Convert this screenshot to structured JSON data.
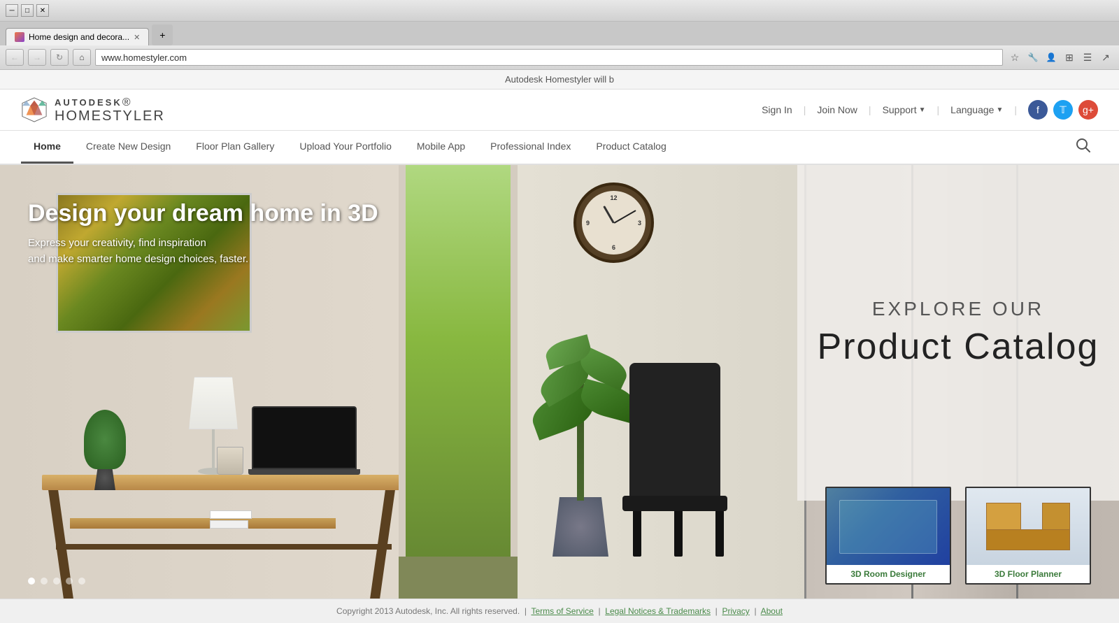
{
  "browser": {
    "tab_title": "Home design and decora...",
    "url": "www.homestyler.com",
    "loading": false
  },
  "notification": {
    "text": "Autodesk Homestyler will b"
  },
  "header": {
    "logo_brand": "AUTODESK",
    "logo_product": "HOMESTYLER",
    "sign_in": "Sign In",
    "join_now": "Join Now",
    "support": "Support",
    "language": "Language"
  },
  "nav": {
    "items": [
      {
        "label": "Home",
        "active": true
      },
      {
        "label": "Create New Design",
        "active": false
      },
      {
        "label": "Floor Plan Gallery",
        "active": false
      },
      {
        "label": "Upload Your Portfolio",
        "active": false
      },
      {
        "label": "Mobile App",
        "active": false
      },
      {
        "label": "Professional Index",
        "active": false
      },
      {
        "label": "Product Catalog",
        "active": false
      }
    ]
  },
  "hero": {
    "title": "Design your dream home in 3D",
    "subtitle_line1": "Express your creativity, find inspiration",
    "subtitle_line2": "and make smarter home design choices, faster.",
    "explore_label": "EXPLORE OUR",
    "catalog_label": "Product Catalog"
  },
  "thumbnails": [
    {
      "label": "3D Room Designer",
      "type": "room"
    },
    {
      "label": "3D Floor Planner",
      "type": "floor"
    }
  ],
  "dots": [
    {
      "active": true
    },
    {
      "active": false
    },
    {
      "active": false
    },
    {
      "active": false
    },
    {
      "active": false
    }
  ],
  "footer": {
    "copyright": "Copyright 2013 Autodesk, Inc. All rights reserved.",
    "terms_link": "Terms of Service",
    "legal_link": "Legal Notices & Trademarks",
    "privacy_link": "Privacy",
    "about_link": "About"
  }
}
